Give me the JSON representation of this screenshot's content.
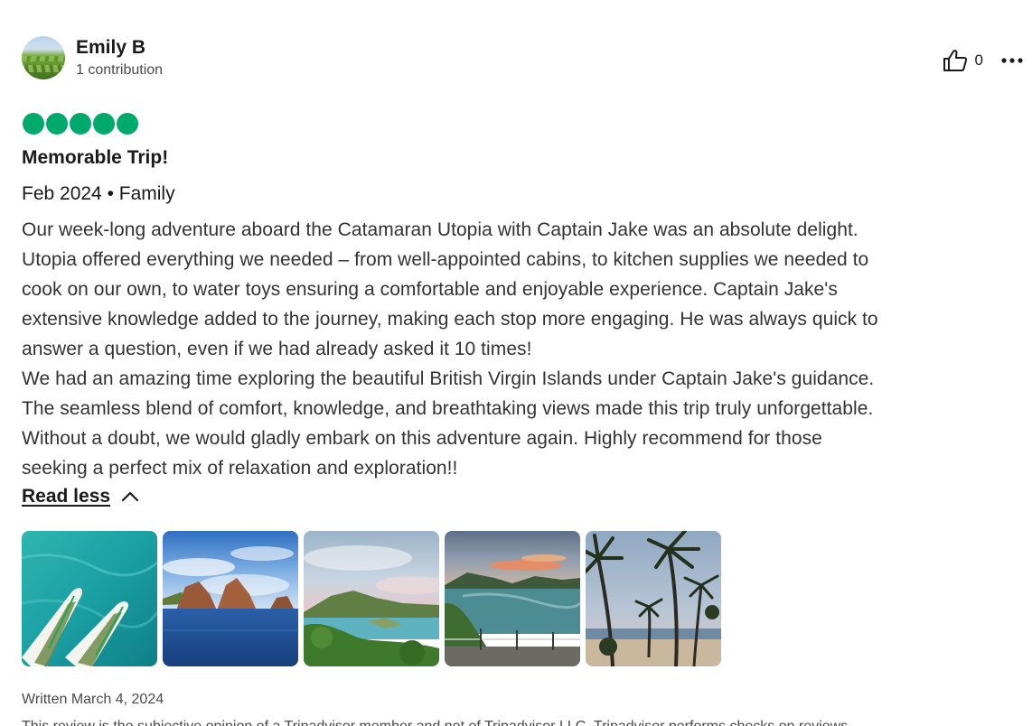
{
  "user": {
    "name": "Emily B",
    "contributions": "1 contribution"
  },
  "actions": {
    "helpful_count": "0",
    "helpful_icon": "thumbs-up-icon",
    "more_icon": "more-dots-icon"
  },
  "review": {
    "rating": 5,
    "rating_color": "#00aa6c",
    "title": "Memorable Trip!",
    "trip_meta": "Feb 2024 • Family",
    "body_lines": [
      "Our week-long adventure aboard the Catamaran Utopia with Captain Jake was an absolute delight.",
      "Utopia offered everything we needed – from well-appointed cabins, to kitchen supplies we needed to",
      "cook on our own, to water toys ensuring a comfortable and enjoyable experience. Captain Jake's",
      "extensive knowledge added to the journey, making each stop more engaging. He was always quick to",
      "answer a question, even if we had already asked it 10 times!",
      "We had an amazing time exploring the beautiful British Virgin Islands under Captain Jake's guidance.",
      "The seamless blend of comfort, knowledge, and breathtaking views made this trip truly unforgettable.",
      "Without a doubt, we would gladly embark on this adventure again. Highly recommend for those",
      "seeking a perfect mix of relaxation and exploration!!"
    ],
    "read_less_label": "Read less",
    "written": "Written March 4, 2024",
    "disclaimer": "This review is the subjective opinion of a Tripadvisor member and not of Tripadvisor LLC. Tripadvisor performs checks on reviews."
  },
  "photos": [
    {
      "name": "photo-paddleboards"
    },
    {
      "name": "photo-rock-island"
    },
    {
      "name": "photo-coastline-hills"
    },
    {
      "name": "photo-sunset-bay"
    },
    {
      "name": "photo-palm-trees"
    }
  ]
}
